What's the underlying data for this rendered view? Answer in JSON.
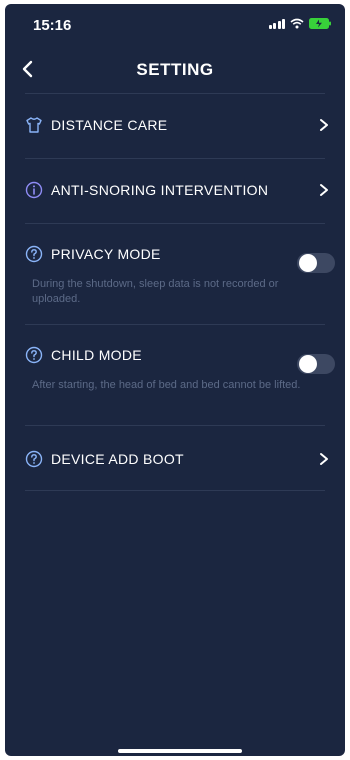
{
  "status_bar": {
    "time": "15:16"
  },
  "header": {
    "title": "SETTING"
  },
  "items": [
    {
      "label": "DISTANCE CARE",
      "icon": "shirt-icon",
      "type": "nav"
    },
    {
      "label": "ANTI-SNORING INTERVENTION",
      "icon": "info-icon",
      "type": "nav"
    },
    {
      "label": "PRIVACY MODE",
      "icon": "help-icon",
      "type": "toggle",
      "on": false,
      "description": "During the shutdown, sleep data is not recorded or uploaded."
    },
    {
      "label": "CHILD MODE",
      "icon": "help-icon",
      "type": "toggle",
      "on": false,
      "description": "After starting, the head of bed and bed cannot be lifted."
    },
    {
      "label": "DEVICE ADD BOOT",
      "icon": "help-icon",
      "type": "nav"
    }
  ],
  "colors": {
    "background": "#1b2640",
    "icon_accent": "#8ab4f8",
    "info_accent": "#8f8cf5",
    "description_text": "#5c6a87",
    "divider": "#2e3a55"
  }
}
